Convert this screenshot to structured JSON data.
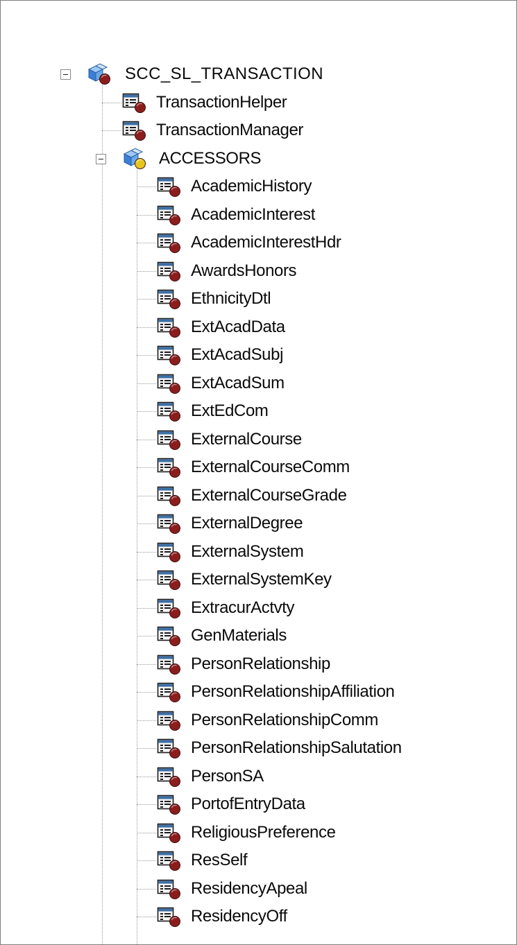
{
  "tree": {
    "root": {
      "label": "SCC_SL_TRANSACTION",
      "icon": "package-icon",
      "expanded": true,
      "children": [
        {
          "label": "TransactionHelper",
          "icon": "app-class-icon"
        },
        {
          "label": "TransactionManager",
          "icon": "app-class-icon"
        }
      ],
      "subpackage": {
        "label": "ACCESSORS",
        "icon": "subpackage-icon",
        "expanded": true,
        "children": [
          "AcademicHistory",
          "AcademicInterest",
          "AcademicInterestHdr",
          "AwardsHonors",
          "EthnicityDtl",
          "ExtAcadData",
          "ExtAcadSubj",
          "ExtAcadSum",
          "ExtEdCom",
          "ExternalCourse",
          "ExternalCourseComm",
          "ExternalCourseGrade",
          "ExternalDegree",
          "ExternalSystem",
          "ExternalSystemKey",
          "ExtracurActvty",
          "GenMaterials",
          "PersonRelationship",
          "PersonRelationshipAffiliation",
          "PersonRelationshipComm",
          "PersonRelationshipSalutation",
          "PersonSA",
          "PortofEntryData",
          "ReligiousPreference",
          "ResSelf",
          "ResidencyApeal",
          "ResidencyOff"
        ]
      }
    }
  }
}
